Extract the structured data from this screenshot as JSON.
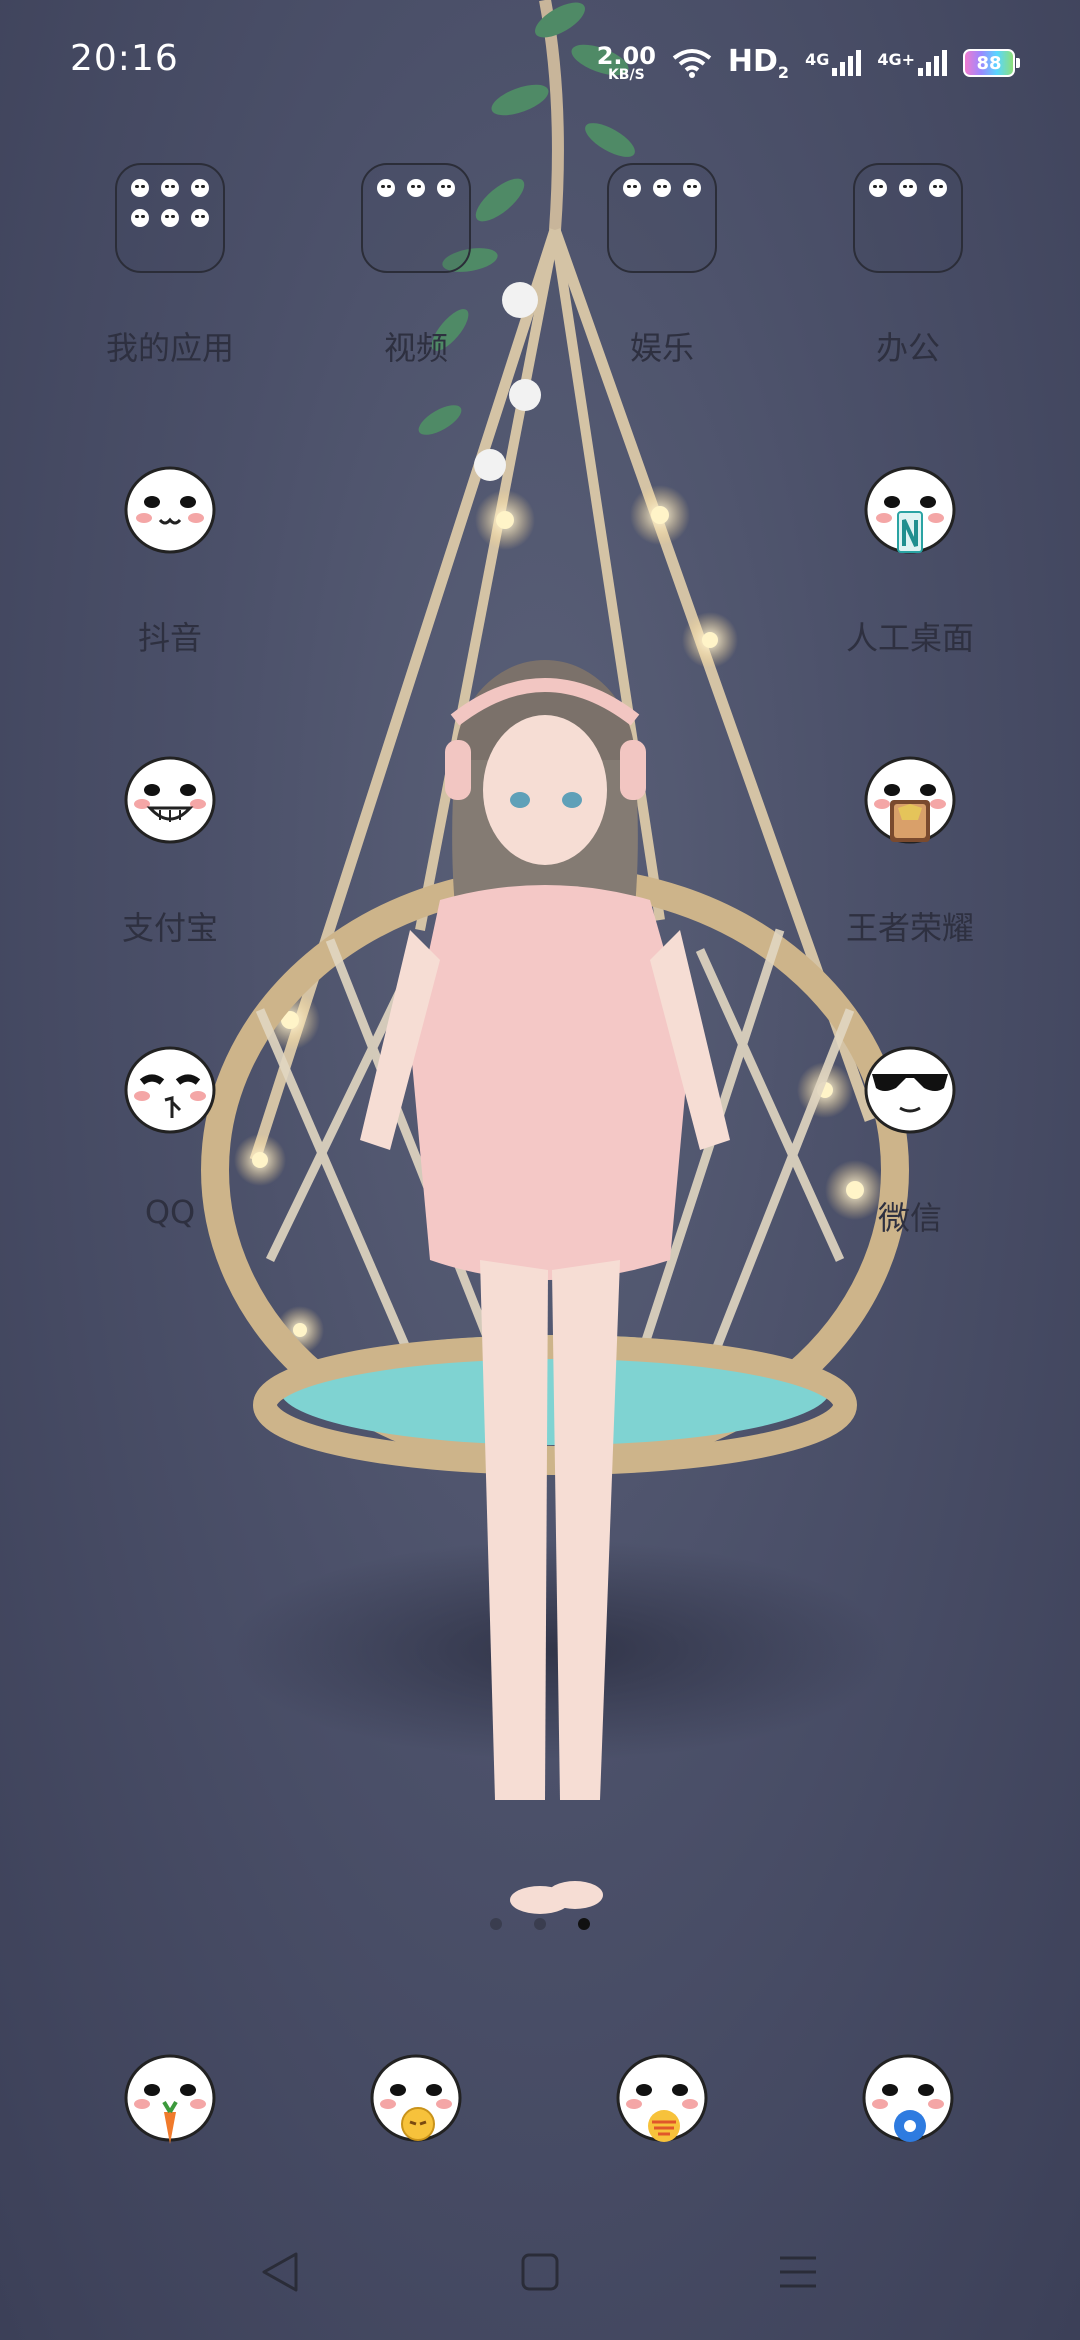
{
  "status_bar": {
    "time": "20:16",
    "net_speed_value": "2.00",
    "net_speed_unit": "KB/S",
    "hd_label": "HD",
    "hd_sub": "2",
    "signal1_label": "4G",
    "signal2_label": "4G+",
    "battery_level": "88"
  },
  "folders": [
    {
      "label": "我的应用"
    },
    {
      "label": "视频"
    },
    {
      "label": "娱乐"
    },
    {
      "label": "办公"
    }
  ],
  "apps": [
    {
      "label": "抖音"
    },
    {
      "label": "人工桌面"
    },
    {
      "label": "支付宝"
    },
    {
      "label": "王者荣耀"
    },
    {
      "label": "QQ"
    },
    {
      "label": "微信"
    }
  ],
  "page_indicator": {
    "count": 3,
    "active": 3
  },
  "dock_apps": [
    {
      "name": "dock-app-1"
    },
    {
      "name": "dock-app-2"
    },
    {
      "name": "dock-app-3"
    },
    {
      "name": "dock-app-4"
    }
  ]
}
